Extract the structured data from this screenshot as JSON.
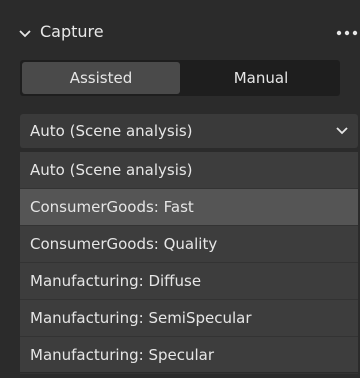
{
  "section": {
    "title": "Capture",
    "collapse_icon": "chevron-down-icon",
    "more_icon": "more-horizontal-icon"
  },
  "mode_toggle": {
    "options": [
      "Assisted",
      "Manual"
    ],
    "selected": "Assisted"
  },
  "preset_dropdown": {
    "selected": "Auto (Scene analysis)",
    "chevron_icon": "chevron-down-icon",
    "options": [
      "Auto (Scene analysis)",
      "ConsumerGoods: Fast",
      "ConsumerGoods: Quality",
      "Manufacturing: Diffuse",
      "Manufacturing: SemiSpecular",
      "Manufacturing: Specular"
    ],
    "hovered": "ConsumerGoods: Fast"
  },
  "colors": {
    "panel_bg": "#2b2b2b",
    "toggle_bg": "#1e1e1e",
    "toggle_active": "#4a4a4a",
    "dropdown_bg": "#3a3a3a",
    "menu_bg": "#3d3d3d",
    "menu_hover": "#555555",
    "text": "#e6e6e6"
  }
}
